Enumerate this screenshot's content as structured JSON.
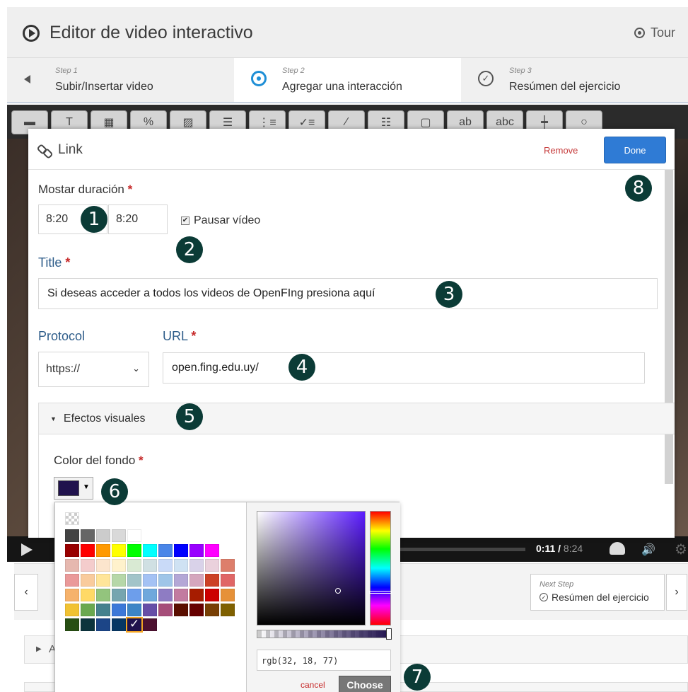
{
  "header": {
    "title": "Editor de video interactivo",
    "tour_label": "Tour"
  },
  "steps": [
    {
      "num": "Step 1",
      "label": "Subir/Insertar video",
      "icon": "camera-icon"
    },
    {
      "num": "Step 2",
      "label": "Agregar una interacción",
      "icon": "tap-icon"
    },
    {
      "num": "Step 3",
      "label": "Resúmen del ejercicio",
      "icon": "check-circle-icon"
    }
  ],
  "toolbar": {
    "tools": [
      "▬",
      "T",
      "▦",
      "%",
      "▨",
      "☰",
      "⋮≡",
      "✓≡",
      "⁄",
      "☷",
      "▢",
      "ab",
      "abc",
      "┿",
      "○"
    ]
  },
  "video": {
    "time_current": "0:11",
    "time_total": "8:24"
  },
  "dialog": {
    "title": "Link",
    "remove_label": "Remove",
    "done_label": "Done",
    "duration_label": "Mostar duración",
    "start_time": "8:20",
    "end_time": "8:20",
    "pause_label": "Pausar vídeo",
    "pause_checked": true,
    "title_label": "Title",
    "title_value": "Si deseas acceder a todos los videos de OpenFIng presiona aquí",
    "protocol_label": "Protocol",
    "protocol_value": "https://",
    "url_label": "URL",
    "url_value": "open.fing.edu.uy/",
    "visual_effects_label": "Efectos visuales",
    "bg_color_label": "Color del fondo",
    "selected_color": "#20124d"
  },
  "picker": {
    "rgb_value": "rgb(32, 18, 77)",
    "cancel_label": "cancel",
    "choose_label": "Choose",
    "palette": [
      [
        "#434343",
        "#666666",
        "#cccccc",
        "#d9d9d9",
        "#ffffff"
      ],
      [
        "#980000",
        "#ff0000",
        "#ff9900",
        "#ffff00",
        "#00ff00",
        "#00ffff",
        "#4a86e8",
        "#0000ff",
        "#9900ff",
        "#ff00ff"
      ],
      [
        "#e6b8af",
        "#f4cccc",
        "#fce5cd",
        "#fff2cc",
        "#d9ead3",
        "#d0e0e3",
        "#c9daf8",
        "#cfe2f3",
        "#d9d2e9",
        "#ead1dc",
        "#dd7e6b"
      ],
      [
        "#ea9999",
        "#f9cb9c",
        "#ffe599",
        "#b6d7a8",
        "#a2c4c9",
        "#a4c2f4",
        "#9fc5e8",
        "#b4a7d6",
        "#d5a6bd",
        "#cc4125",
        "#e06666"
      ],
      [
        "#f6b26b",
        "#ffd966",
        "#93c47d",
        "#76a5af",
        "#6d9eeb",
        "#6fa8dc",
        "#8e7cc3",
        "#c27ba0",
        "#a61c00",
        "#cc0000",
        "#e69138"
      ],
      [
        "#f1c232",
        "#6aa84f",
        "#45818e",
        "#3c78d8",
        "#3d85c6",
        "#674ea7",
        "#a64d79",
        "#5b0f00",
        "#660000",
        "#783f04",
        "#7f6000"
      ],
      [
        "#274e13",
        "#0c343d",
        "#1c4587",
        "#073763",
        "#20124d",
        "#4c1130"
      ]
    ]
  },
  "lower_nav": {
    "prev_arrow": "‹",
    "next_label": "Next Step",
    "next_title": "Resúmen del ejercicio",
    "next_arrow": "›",
    "accordion_letter": "A"
  },
  "badges": [
    "1",
    "2",
    "3",
    "4",
    "5",
    "6",
    "7",
    "8"
  ],
  "colors": {
    "accent_blue": "#2f7bd5",
    "label_blue": "#2e5d8a",
    "required_red": "#c62828",
    "badge": "#0b3b36"
  }
}
